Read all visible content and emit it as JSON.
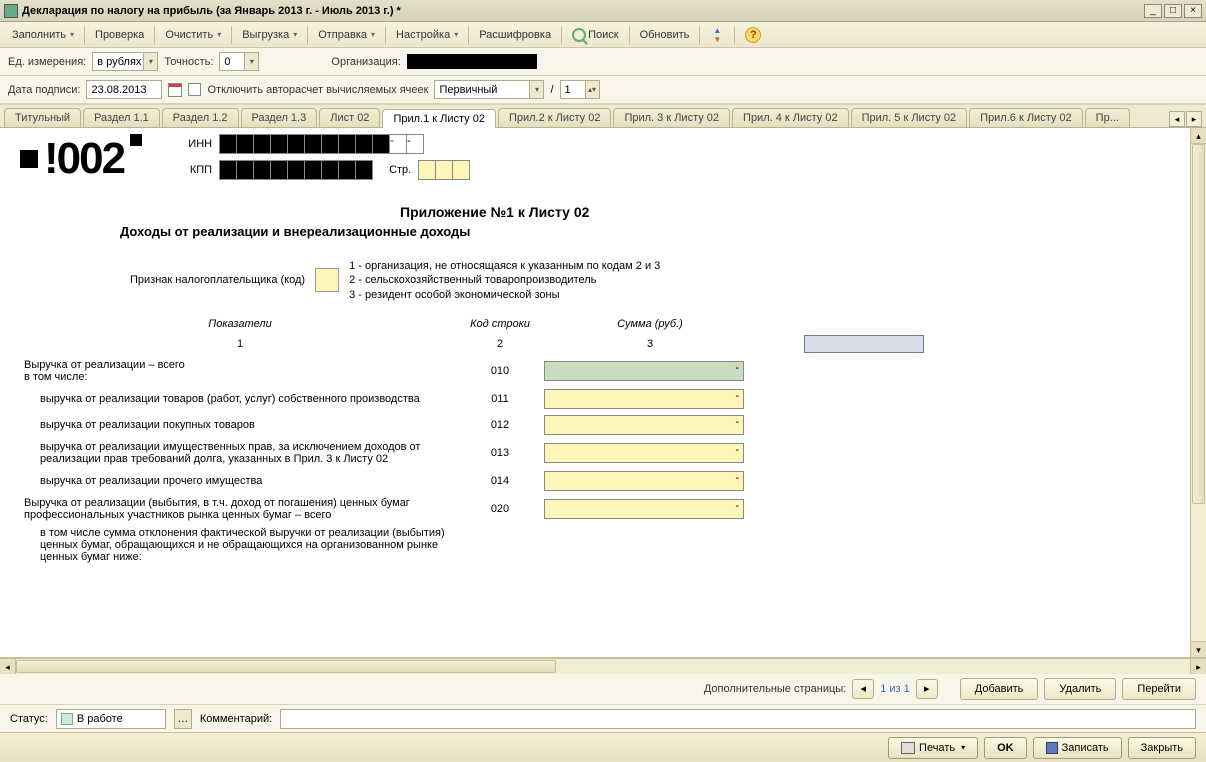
{
  "window": {
    "title": "Декларация по налогу на прибыль (за Январь 2013 г. - Июль 2013 г.) *"
  },
  "toolbar": {
    "fill": "Заполнить",
    "check": "Проверка",
    "clear": "Очистить",
    "export": "Выгрузка",
    "send": "Отправка",
    "settings": "Настройка",
    "decode": "Расшифровка",
    "search": "Поиск",
    "refresh": "Обновить"
  },
  "form": {
    "unit_label": "Ед. измерения:",
    "unit_value": "в рублях",
    "precision_label": "Точность:",
    "precision_value": "0",
    "org_label": "Организация:",
    "date_label": "Дата подписи:",
    "date_value": "23.08.2013",
    "autocalc_label": "Отключить авторасчет вычисляемых ячеек",
    "doc_type": "Первичный",
    "slash": "/",
    "page_num": "1"
  },
  "tabs": [
    "Титульный",
    "Раздел 1.1",
    "Раздел 1.2",
    "Раздел 1.3",
    "Лист 02",
    "Прил.1 к Листу 02",
    "Прил.2 к Листу 02",
    "Прил. 3 к Листу 02",
    "Прил. 4 к Листу 02",
    "Прил. 5 к Листу 02",
    "Прил.6 к Листу 02",
    "Пр..."
  ],
  "active_tab_index": 5,
  "sheet": {
    "barcode_num": "!002",
    "inn_label": "ИНН",
    "kpp_label": "КПП",
    "str_label": "Стр.",
    "app_title": "Приложение №1 к Листу 02",
    "app_subtitle": "Доходы от реализации и внереализационные доходы",
    "taxpayer_label": "Признак налогоплательщика (код)",
    "taxpayer_desc1": "1 - организация, не относящаяся к указанным по кодам 2 и 3",
    "taxpayer_desc2": "2 - сельскохозяйственный товаропроизводитель",
    "taxpayer_desc3": "3 - резидент особой экономической зоны",
    "col_indicator": "Показатели",
    "col_code": "Код строки",
    "col_sum": "Сумма (руб.)",
    "col_n1": "1",
    "col_n2": "2",
    "col_n3": "3",
    "rows": [
      {
        "label": "Выручка от реализации – всего",
        "sub": "в том числе:",
        "code": "010",
        "green": true,
        "dash": "-"
      },
      {
        "label": "выручка от реализации товаров (работ, услуг) собственного производства",
        "code": "011",
        "indent": true,
        "dash": "-"
      },
      {
        "label": "выручка от реализации покупных товаров",
        "code": "012",
        "indent": true,
        "dash": "-"
      },
      {
        "label": "выручка от реализации имущественных прав, за исключением доходов от реализации прав требований долга, указанных в Прил. 3 к Листу 02",
        "code": "013",
        "indent": true,
        "dash": "-"
      },
      {
        "label": "выручка от реализации прочего имущества",
        "code": "014",
        "indent": true,
        "dash": "-"
      },
      {
        "label": "Выручка от реализации (выбытия, в т.ч. доход от погашения) ценных бумаг профессиональных участников рынка ценных бумаг – всего",
        "code": "020",
        "dash": "-"
      },
      {
        "label": "в том числе сумма отклонения фактической выручки от реализации (выбытия) ценных бумаг, обращающихся и не обращающихся на организованном рынке ценных бумаг ниже:",
        "code": "",
        "indent": true
      }
    ]
  },
  "pager": {
    "label": "Дополнительные страницы:",
    "pos": "1 из 1",
    "add": "Добавить",
    "delete": "Удалить",
    "goto": "Перейти"
  },
  "status": {
    "label": "Статус:",
    "value": "В работе",
    "comment_label": "Комментарий:"
  },
  "footer": {
    "print": "Печать",
    "ok": "OK",
    "save": "Записать",
    "close": "Закрыть"
  }
}
